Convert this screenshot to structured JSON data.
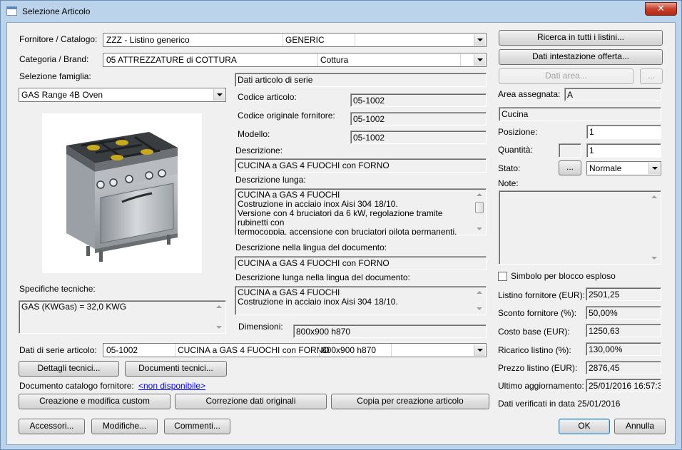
{
  "window": {
    "title": "Selezione Articolo",
    "close": "✕"
  },
  "fornitore": {
    "label": "Fornitore / Catalogo:",
    "name": "ZZZ - Listino generico",
    "code": "GENERIC"
  },
  "categoria": {
    "label": "Categoria / Brand:",
    "name": "05 ATTREZZATURE di COTTURA",
    "brand": "Cottura"
  },
  "famiglia": {
    "label": "Selezione famiglia:",
    "value": "GAS Range 4B Oven"
  },
  "specifiche": {
    "label": "Specifiche tecniche:",
    "value": "GAS (KWGas) = 32,0 KWG"
  },
  "articolo": {
    "header": "Dati articolo di serie",
    "codice_label": "Codice articolo:",
    "codice": "05-1002",
    "codice_orig_label": "Codice originale fornitore:",
    "codice_orig": "05-1002",
    "modello_label": "Modello:",
    "modello": "05-1002",
    "descrizione_label": "Descrizione:",
    "descrizione": "CUCINA a GAS 4 FUOCHI con FORNO",
    "desc_lunga_label": "Descrizione lunga:",
    "desc_lunga": [
      "CUCINA a GAS 4 FUOCHI",
      "Costruzione in acciaio inox Aisi 304 18/10.",
      "Versione con 4 bruciatori da 6 kW, regolazione tramite rubinetti con",
      "termocoppia, accensione con bruciatori pilota permanenti, griglie in"
    ],
    "desc_lingua_label": "Descrizione nella lingua del documento:",
    "desc_lingua": "CUCINA a GAS 4 FUOCHI con FORNO",
    "desc_lunga_lingua_label": "Descrizione lunga nella lingua del documento:",
    "desc_lunga_lingua": [
      "CUCINA a GAS 4 FUOCHI",
      "Costruzione in acciaio inox Aisi 304 18/10."
    ],
    "dimensioni_label": "Dimensioni:",
    "dimensioni": "800x900 h870"
  },
  "dati_serie": {
    "label": "Dati di serie articolo:",
    "codice": "05-1002",
    "descrizione": "CUCINA a GAS 4 FUOCHI con FORNO",
    "dim": "800x900 h870"
  },
  "buttons": {
    "dettagli": "Dettagli tecnici...",
    "documenti": "Documenti tecnici...",
    "creazione": "Creazione e modifica custom",
    "correzione": "Correzione dati originali",
    "copia": "Copia per creazione articolo",
    "accessori": "Accessori...",
    "modifiche": "Modifiche...",
    "commenti": "Commenti...",
    "ricerca": "Ricerca in tutti i listini...",
    "intestazione": "Dati intestazione offerta...",
    "dati_area": "Dati area...",
    "dati_area_more": "...",
    "stato_more": "...",
    "ok": "OK",
    "annulla": "Annulla"
  },
  "documento": {
    "label": "Documento catalogo fornitore:",
    "link": "<non disponibile>"
  },
  "right": {
    "area_label": "Area assegnata:",
    "area": "A",
    "area_name": "Cucina",
    "posizione_label": "Posizione:",
    "posizione": "1",
    "quantita_label": "Quantità:",
    "quantita_unit": "",
    "quantita": "1",
    "stato_label": "Stato:",
    "stato": "Normale",
    "note_label": "Note:",
    "note": "",
    "simbolo_label": "Simbolo per blocco esploso",
    "listino_label": "Listino fornitore (EUR):",
    "listino": "2501,25",
    "sconto_label": "Sconto fornitore (%):",
    "sconto": "50,00%",
    "costo_label": "Costo base (EUR):",
    "costo": "1250,63",
    "ricarico_label": "Ricarico listino (%):",
    "ricarico": "130,00%",
    "prezzo_label": "Prezzo listino (EUR):",
    "prezzo": "2876,45",
    "ultimo_label": "Ultimo aggiornamento:",
    "ultimo": "25/01/2016 16:57:30",
    "verificati": "Dati verificati in data 25/01/2016"
  }
}
